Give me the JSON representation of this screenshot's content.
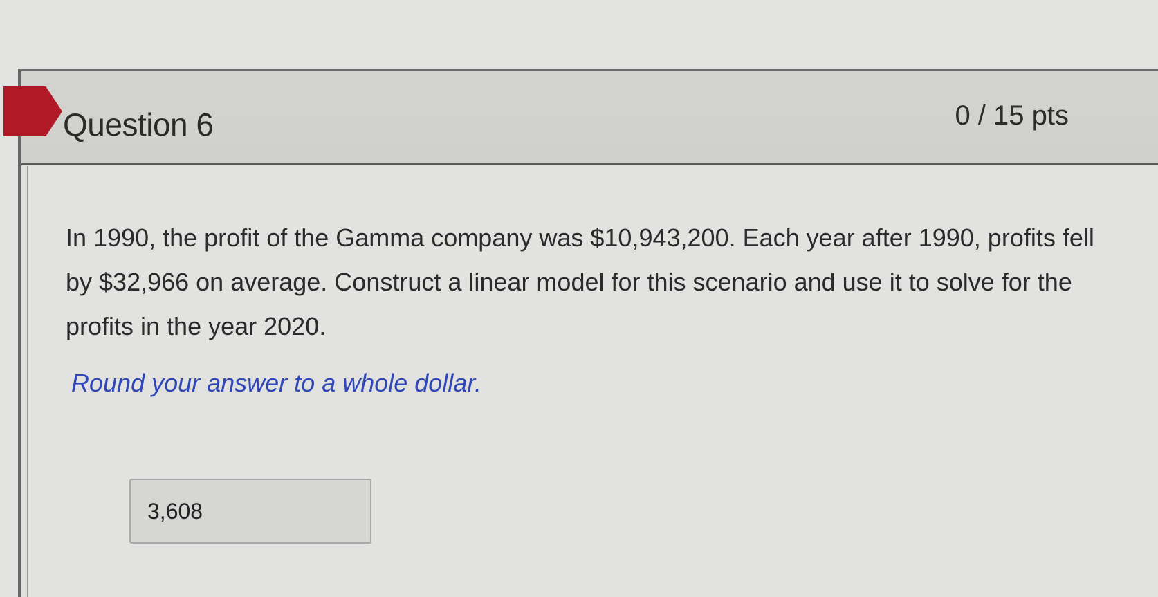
{
  "question": {
    "title": "Question 6",
    "points": "0 / 15 pts",
    "text": "In 1990, the profit of the Gamma company was $10,943,200. Each year after 1990, profits fell by $32,966 on average. Construct a linear model for this scenario and use it to solve for the profits in the year 2020.",
    "hint": "Round your answer to a whole dollar.",
    "answer_value": "3,608"
  },
  "colors": {
    "flag": "#b01a26",
    "hint": "#2f47b7"
  }
}
